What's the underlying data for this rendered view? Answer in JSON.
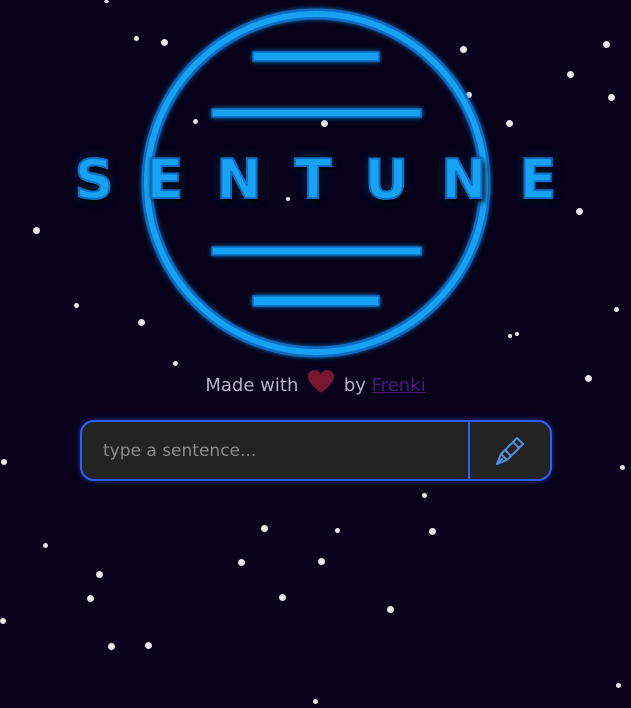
{
  "app": {
    "title": "SENTUNE",
    "brand_color": "#17a3f5"
  },
  "credit": {
    "prefix": "Made with",
    "by": "by",
    "author": "Frenki",
    "heart_color": "#7a1531"
  },
  "search": {
    "value": "",
    "placeholder": "type a sentence...",
    "submit_icon": "pen-nib-icon",
    "border_color": "#2f5cff"
  },
  "background": {
    "color": "#07021a",
    "decoration": "starfield"
  }
}
